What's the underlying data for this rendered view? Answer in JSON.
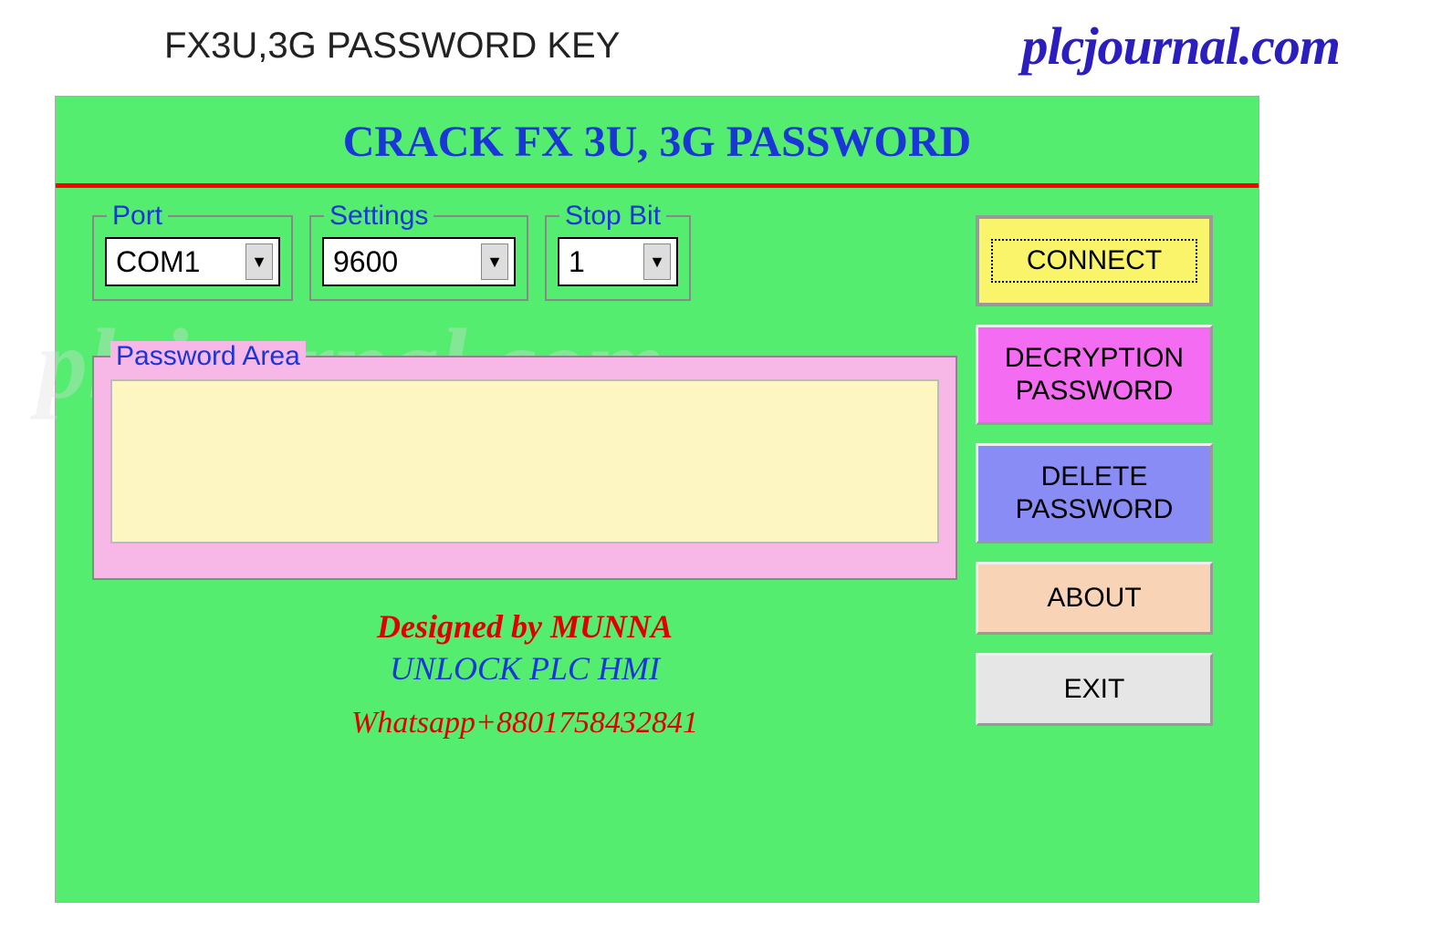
{
  "titlebar": {
    "title": "FX3U,3G PASSWORD KEY",
    "brand": "plcjournal.com"
  },
  "heading": "CRACK FX 3U, 3G PASSWORD",
  "config": {
    "port": {
      "label": "Port",
      "value": "COM1"
    },
    "settings": {
      "label": "Settings",
      "value": "9600"
    },
    "stopbit": {
      "label": "Stop Bit",
      "value": "1"
    }
  },
  "password_area": {
    "label": "Password Area",
    "value": ""
  },
  "credits": {
    "line1": "Designed by MUNNA",
    "line2": "UNLOCK PLC HMI",
    "line3": "Whatsapp+8801758432841"
  },
  "buttons": {
    "connect": "CONNECT",
    "decrypt": "DECRYPTION PASSWORD",
    "delete": "DELETE PASSWORD",
    "about": "ABOUT",
    "exit": "EXIT"
  },
  "watermark": "plcjournal.com"
}
